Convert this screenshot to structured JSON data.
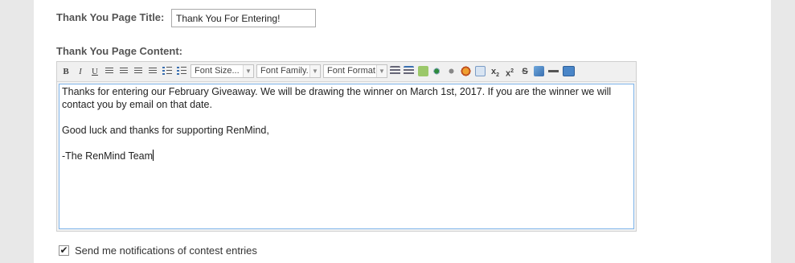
{
  "form": {
    "title_label": "Thank You Page Title:",
    "title_value": "Thank You For Entering!",
    "content_label": "Thank You Page Content:",
    "notify_label": "Send me notifications of contest entries",
    "notify_checked": true
  },
  "toolbar": {
    "bold": "B",
    "italic": "I",
    "underline": "U",
    "font_size": "Font Size...",
    "font_family": "Font Family.",
    "font_format": "Font Format",
    "subscript": "x",
    "superscript": "x",
    "strike": "S",
    "icons": [
      "outdent-icon",
      "indent-icon",
      "highlight-icon",
      "link-icon",
      "unlink-icon",
      "image-icon",
      "edit-icon",
      "subscript-icon",
      "superscript-icon",
      "strikethrough-icon",
      "insert-special-icon",
      "horizontal-rule-icon",
      "html-source-icon"
    ],
    "colors": {
      "accent": "#3a6fb0",
      "focus_border": "#7eb4ea"
    }
  },
  "editor": {
    "line1": "Thanks for entering our February Giveaway. We will be drawing the winner on March 1st, 2017. If you are the winner we will contact you by email on that date.",
    "line2": "Good luck and thanks for supporting RenMind,",
    "line3": "-The RenMind Team"
  }
}
